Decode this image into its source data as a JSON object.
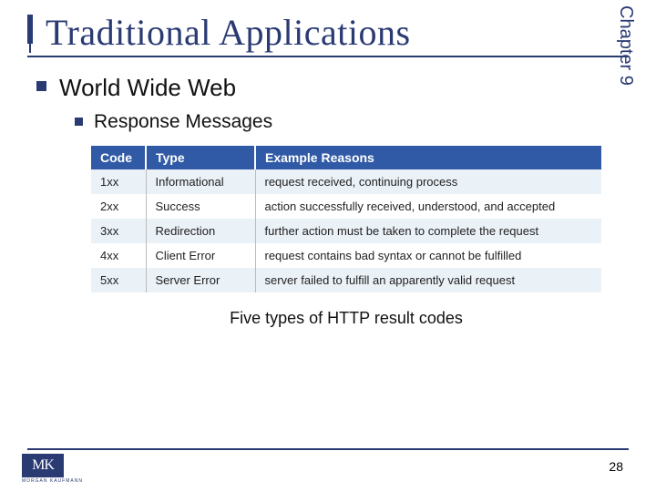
{
  "chapter_tab": "Chapter 9",
  "title": "Traditional Applications",
  "bullets": {
    "level1": "World Wide Web",
    "level2": "Response Messages"
  },
  "table": {
    "headers": {
      "code": "Code",
      "type": "Type",
      "reasons": "Example Reasons"
    },
    "rows": [
      {
        "code": "1xx",
        "type": "Informational",
        "reason": "request received, continuing process"
      },
      {
        "code": "2xx",
        "type": "Success",
        "reason": "action successfully received, understood, and accepted"
      },
      {
        "code": "3xx",
        "type": "Redirection",
        "reason": "further action must be taken to complete the request"
      },
      {
        "code": "4xx",
        "type": "Client Error",
        "reason": "request contains bad syntax or cannot be fulfilled"
      },
      {
        "code": "5xx",
        "type": "Server Error",
        "reason": "server failed to fulfill an apparently valid request"
      }
    ]
  },
  "caption": "Five types of HTTP result codes",
  "page_number": "28",
  "logo": {
    "initials": "MK",
    "publisher": "MORGAN KAUFMANN"
  }
}
